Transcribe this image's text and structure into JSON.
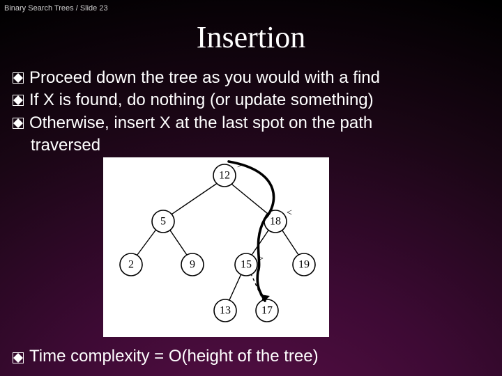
{
  "breadcrumb": "Binary Search Trees / Slide 23",
  "title": "Insertion",
  "bullets": {
    "b1": "Proceed down the tree as you would with a find",
    "b2": "If X is found, do nothing (or update something)",
    "b3": "Otherwise, insert X at the last spot on the path",
    "b3_cont": "traversed",
    "b4": "Time complexity = O(height of the tree)"
  },
  "tree": {
    "nodes": {
      "n12": "12",
      "n5": "5",
      "n18": "18",
      "n2": "2",
      "n9": "9",
      "n15": "15",
      "n19": "19",
      "n13": "13",
      "n17": "17"
    },
    "cmp_gt": ">",
    "cmp_lt": "<"
  }
}
